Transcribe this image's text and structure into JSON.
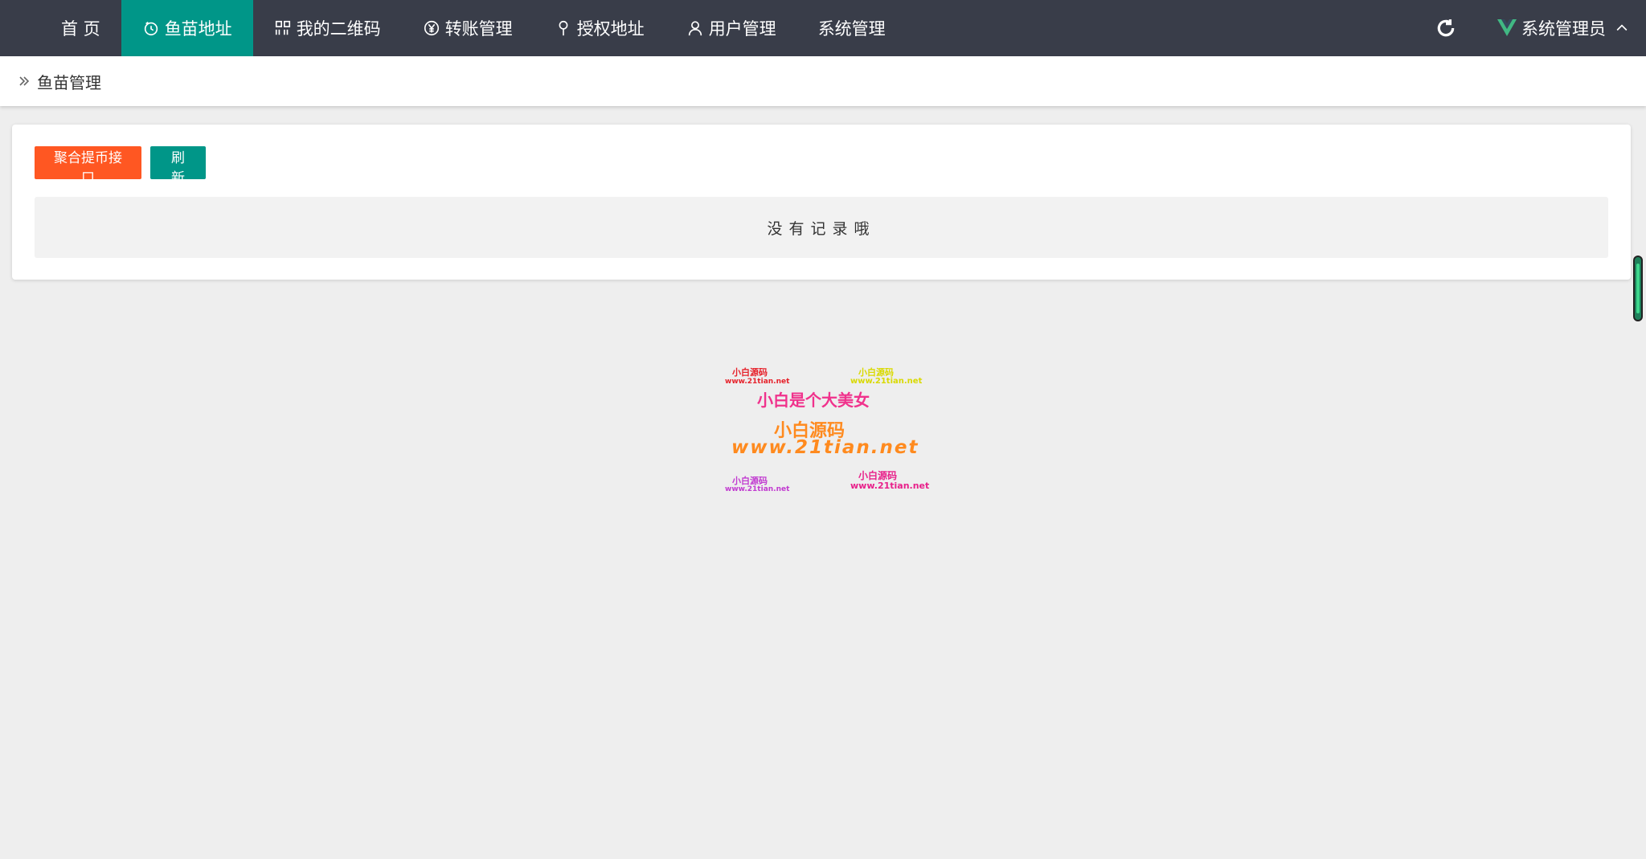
{
  "nav": {
    "items": [
      {
        "label": "首 页",
        "icon": ""
      },
      {
        "label": "鱼苗地址",
        "icon": "clock-icon"
      },
      {
        "label": "我的二维码",
        "icon": "qrcode-icon"
      },
      {
        "label": "转账管理",
        "icon": "yen-icon"
      },
      {
        "label": "授权地址",
        "icon": "location-pin-icon"
      },
      {
        "label": "用户管理",
        "icon": "user-icon"
      },
      {
        "label": "系统管理",
        "icon": ""
      }
    ],
    "active_index": 1,
    "user_name": "系统管理员"
  },
  "breadcrumb": {
    "label": "鱼苗管理"
  },
  "toolbar": {
    "aggregate_label": "聚合提币接口",
    "refresh_label": "刷 新"
  },
  "table": {
    "empty_text": "没有记录哦"
  },
  "watermark": {
    "small_1": "小白源码",
    "small_1_url": "www.21tian.net",
    "small_2": "小白源码",
    "small_2_url": "www.21tian.net",
    "main_text": "小白是个大美女",
    "brand": "小白源码",
    "brand_url": "www.21tian.net",
    "small_3": "小白源码",
    "small_3_url": "www.21tian.net",
    "small_4": "小白源码",
    "small_4_url": "www.21tian.net"
  },
  "colors": {
    "topbar": "#393d49",
    "active": "#009688",
    "orange_button": "#ff5722",
    "teal_button": "#009688",
    "background": "#eeeeee"
  }
}
